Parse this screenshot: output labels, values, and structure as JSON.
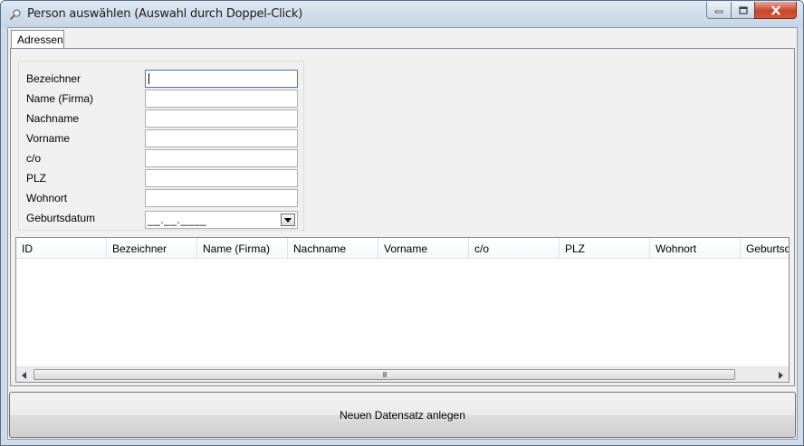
{
  "window": {
    "title": "Person auswählen (Auswahl durch Doppel-Click)",
    "icon": "magnifier-icon"
  },
  "tabs": [
    {
      "label": "Adressen",
      "active": true
    }
  ],
  "form": {
    "fields": [
      {
        "label": "Bezeichner",
        "value": ""
      },
      {
        "label": "Name (Firma)",
        "value": ""
      },
      {
        "label": "Nachname",
        "value": ""
      },
      {
        "label": "Vorname",
        "value": ""
      },
      {
        "label": "c/o",
        "value": ""
      },
      {
        "label": "PLZ",
        "value": ""
      },
      {
        "label": "Wohnort",
        "value": ""
      }
    ],
    "date_field": {
      "label": "Geburtsdatum",
      "mask": "__.__.____"
    }
  },
  "grid": {
    "columns": [
      "ID",
      "Bezeichner",
      "Name (Firma)",
      "Nachname",
      "Vorname",
      "c/o",
      "PLZ",
      "Wohnort",
      "Geburtsda"
    ],
    "rows": []
  },
  "scrollbar": {
    "grip": "III"
  },
  "buttons": {
    "new_record": "Neuen Datensatz anlegen"
  },
  "colors": {
    "close_button": "#c8452d",
    "title_gradient_top": "#dfe8f3",
    "client_bg": "#f0f0f0"
  }
}
